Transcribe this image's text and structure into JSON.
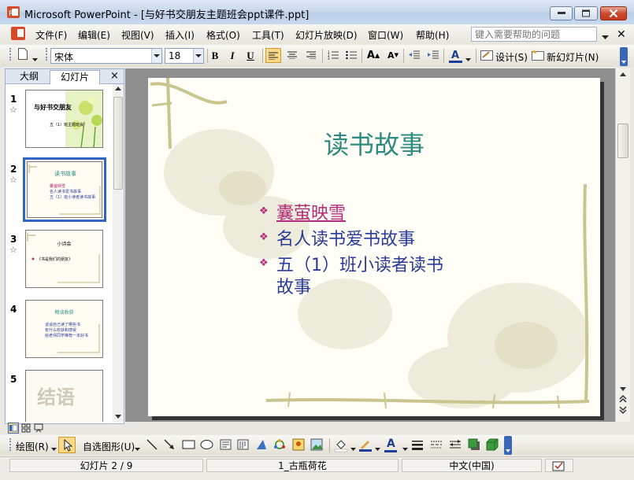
{
  "window": {
    "title": "Microsoft PowerPoint - [与好书交朋友主题班会ppt课件.ppt]"
  },
  "menu": {
    "items": [
      "文件(F)",
      "编辑(E)",
      "视图(V)",
      "插入(I)",
      "格式(O)",
      "工具(T)",
      "幻灯片放映(D)",
      "窗口(W)",
      "帮助(H)"
    ],
    "help_placeholder": "键入需要帮助的问题"
  },
  "toolbar": {
    "font_name": "宋体",
    "font_size": "18",
    "design_label": "设计(S)",
    "new_slide_label": "新幻灯片(N)"
  },
  "left_pane": {
    "tab_outline": "大纲",
    "tab_slides": "幻灯片",
    "close": "×",
    "thumbnails": [
      {
        "number": "1",
        "title": "与好书交朋友",
        "subtitle": "五（1）班主题班会",
        "star": "☆"
      },
      {
        "number": "2",
        "title": "读书故事",
        "lines": [
          "囊萤映雪",
          "名人读书爱书故事",
          "五（1）班小读者读书故事"
        ],
        "star": "☆"
      },
      {
        "number": "3",
        "title": "小诗会",
        "lines": [
          "《书是我们的朋友》"
        ],
        "star": "☆"
      },
      {
        "number": "4",
        "title": "畅谈收获",
        "lines": [
          "谈谈自己读了哪些书",
          "有什么收获和感受",
          "给老师同学推荐一本好书"
        ]
      },
      {
        "number": "5",
        "title": "结语"
      }
    ]
  },
  "slide": {
    "title": "读书故事",
    "bullets": [
      {
        "text": "囊萤映雪",
        "link": true
      },
      {
        "text": "名人读书爱书故事",
        "link": false
      },
      {
        "text": "五（1）班小读者读书",
        "link": false
      },
      {
        "text": "故事",
        "link": false
      }
    ]
  },
  "draw_toolbar": {
    "draw_label": "绘图(R)",
    "autoshapes_label": "自选图形(U)"
  },
  "status": {
    "slide_position": "幻灯片 2 / 9",
    "design_template": "1_古瓶荷花",
    "language": "中文(中国)"
  },
  "colors": {
    "slide_title": "#2d8a7e",
    "slide_text": "#2a3a9a",
    "bullet_accent": "#b52d7a",
    "selection": "#3165c5"
  }
}
